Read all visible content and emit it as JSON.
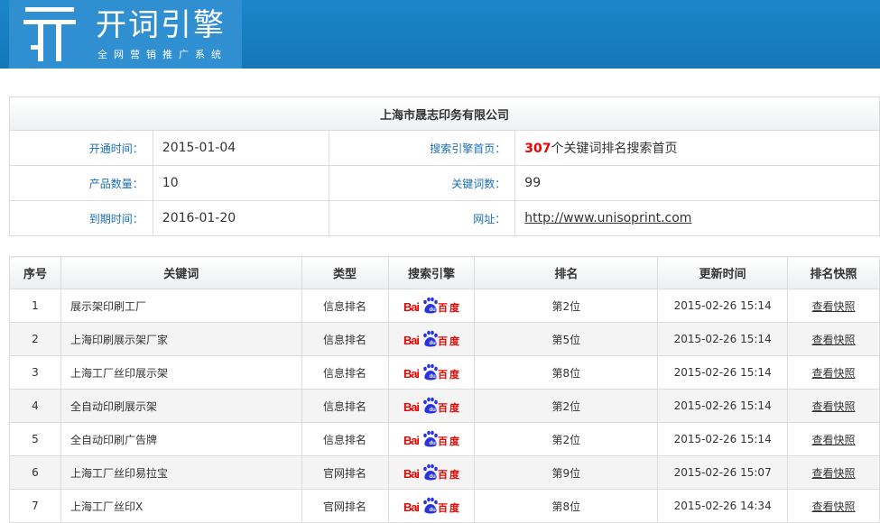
{
  "header": {
    "logo_title": "开词引擎",
    "logo_subtitle": "全网营销推广系统"
  },
  "company": {
    "name": "上海市晟志印务有限公司",
    "open_label": "开通时间：",
    "open_value": "2015-01-04",
    "homepage_label": "搜索引擎首页：",
    "homepage_count": "307",
    "homepage_text": "个关键词排名搜索首页",
    "products_label": "产品数量：",
    "products_value": "10",
    "keywords_label": "关键词数：",
    "keywords_value": "99",
    "expire_label": "到期时间：",
    "expire_value": "2016-01-20",
    "url_label": "网址：",
    "url_value": "http://www.unisoprint.com"
  },
  "table": {
    "headers": [
      "序号",
      "关键词",
      "类型",
      "搜索引擎",
      "排名",
      "更新时间",
      "排名快照"
    ],
    "rows": [
      {
        "no": "1",
        "keyword": "展示架印刷工厂",
        "type": "信息排名",
        "engine": "Baidu百度",
        "rank": "第2位",
        "time": "2015-02-26 15:14",
        "snap": "查看快照"
      },
      {
        "no": "2",
        "keyword": "上海印刷展示架厂家",
        "type": "信息排名",
        "engine": "Baidu百度",
        "rank": "第5位",
        "time": "2015-02-26 15:14",
        "snap": "查看快照"
      },
      {
        "no": "3",
        "keyword": "上海工厂丝印展示架",
        "type": "信息排名",
        "engine": "Baidu百度",
        "rank": "第8位",
        "time": "2015-02-26 15:14",
        "snap": "查看快照"
      },
      {
        "no": "4",
        "keyword": "全自动印刷展示架",
        "type": "信息排名",
        "engine": "Baidu百度",
        "rank": "第2位",
        "time": "2015-02-26 15:14",
        "snap": "查看快照"
      },
      {
        "no": "5",
        "keyword": "全自动印刷广告牌",
        "type": "信息排名",
        "engine": "Baidu百度",
        "rank": "第2位",
        "time": "2015-02-26 15:14",
        "snap": "查看快照"
      },
      {
        "no": "6",
        "keyword": "上海工厂丝印易拉宝",
        "type": "官网排名",
        "engine": "Baidu百度",
        "rank": "第9位",
        "time": "2015-02-26 15:07",
        "snap": "查看快照"
      },
      {
        "no": "7",
        "keyword": "上海工厂丝印X",
        "type": "官网排名",
        "engine": "Baidu百度",
        "rank": "第8位",
        "time": "2015-02-26 14:34",
        "snap": "查看快照"
      }
    ]
  }
}
